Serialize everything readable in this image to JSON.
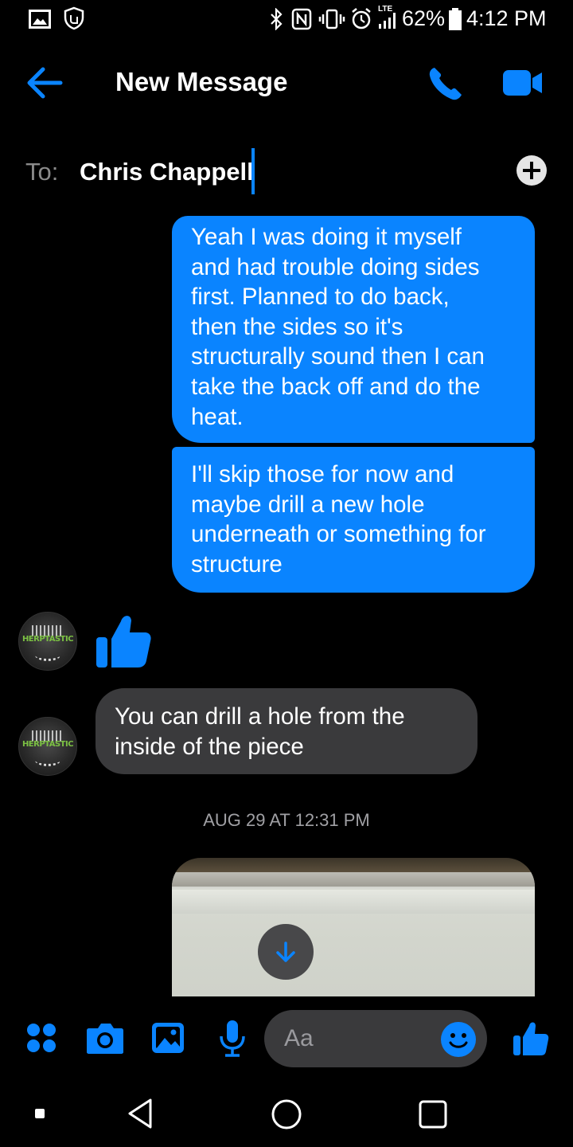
{
  "status_bar": {
    "battery_percent": "62%",
    "time": "4:12 PM",
    "lte_label": "LTE",
    "icons": [
      "gallery-icon",
      "shield-icon",
      "bluetooth-icon",
      "nfc-icon",
      "vibrate-icon",
      "alarm-icon",
      "signal-icon",
      "battery-icon"
    ]
  },
  "header": {
    "title": "New Message",
    "back_icon": "back-arrow-icon",
    "call_icon": "phone-icon",
    "video_icon": "video-camera-icon"
  },
  "to_row": {
    "label": "To:",
    "value": "Chris Chappell",
    "add_icon": "plus-circle-icon"
  },
  "messages": [
    {
      "direction": "outgoing",
      "text": "Yeah I was doing it myself\nand had trouble doing sides\nfirst. Planned to do back,\nthen the sides so it's\nstructurally sound then I can\ntake the back off and do the\nheat."
    },
    {
      "direction": "outgoing",
      "text": "I'll skip those for now and\nmaybe drill a new hole\nunderneath or something for\nstructure"
    },
    {
      "direction": "incoming",
      "type": "thumbs-up"
    },
    {
      "direction": "incoming",
      "text": "You can drill a hole from the\ninside of the piece"
    }
  ],
  "avatar_logo_text": "HERPTASTIC",
  "timestamp": "AUG 29 AT 12:31 PM",
  "composer": {
    "placeholder": "Aa",
    "icons": [
      "apps-grid-icon",
      "camera-icon",
      "image-icon",
      "microphone-icon",
      "emoji-icon",
      "thumbs-up-icon"
    ]
  },
  "nav_bar": {
    "icons": [
      "recents-dot-icon",
      "back-triangle-icon",
      "home-circle-icon",
      "overview-square-icon"
    ]
  },
  "colors": {
    "accent": "#0a84ff",
    "incoming_bubble": "#3a3a3c",
    "background": "#000000"
  }
}
